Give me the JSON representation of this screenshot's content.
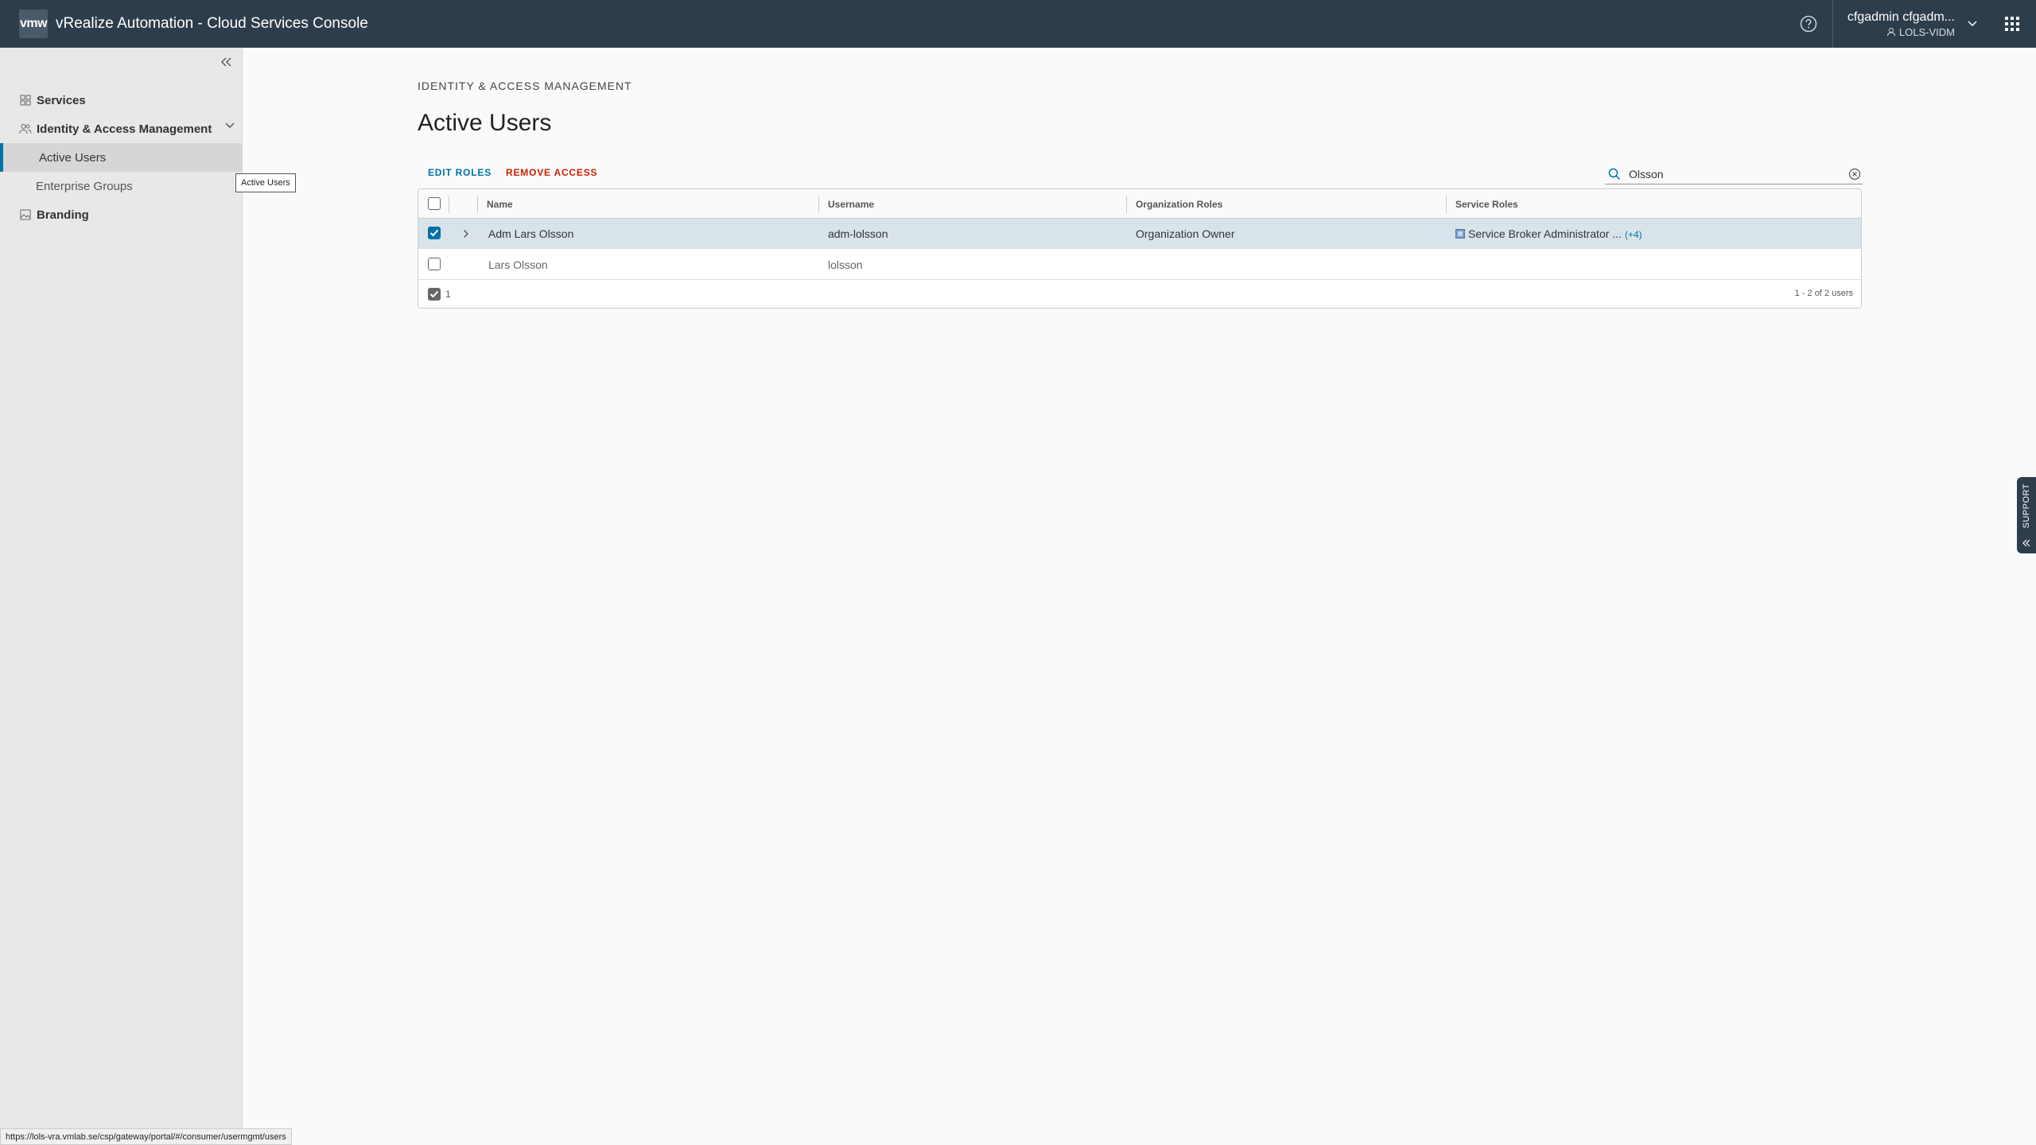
{
  "header": {
    "logo_text": "vmw",
    "app_title": "vRealize Automation - Cloud Services Console",
    "user_name": "cfgadmin cfgadm...",
    "user_org": "LOLS-VIDM"
  },
  "sidebar": {
    "items": [
      {
        "label": "Services",
        "icon": "grid-icon"
      },
      {
        "label": "Identity & Access Management",
        "icon": "users-icon"
      },
      {
        "label": "Active Users"
      },
      {
        "label": "Enterprise Groups"
      },
      {
        "label": "Branding",
        "icon": "image-icon"
      }
    ]
  },
  "tooltip": "Active Users",
  "main": {
    "breadcrumb": "IDENTITY & ACCESS MANAGEMENT",
    "title": "Active Users",
    "actions": {
      "edit_roles": "EDIT ROLES",
      "remove_access": "REMOVE ACCESS"
    },
    "search_value": "Olsson"
  },
  "table": {
    "columns": [
      "Name",
      "Username",
      "Organization Roles",
      "Service Roles"
    ],
    "rows": [
      {
        "name": "Adm Lars Olsson",
        "username": "adm-lolsson",
        "org_roles": "Organization Owner",
        "service_roles": "Service Broker Administrator ...",
        "more": "(+4)",
        "selected": true
      },
      {
        "name": "Lars Olsson",
        "username": "lolsson",
        "org_roles": "",
        "service_roles": "",
        "more": "",
        "selected": false
      }
    ],
    "selected_count": "1",
    "pagination": "1 - 2 of 2 users"
  },
  "support_label": "SUPPORT",
  "status_url": "https://lols-vra.vmlab.se/csp/gateway/portal/#/consumer/usermgmt/users",
  "colors": {
    "header_bg": "#2e3d4b",
    "accent": "#0072a3",
    "danger": "#c92100"
  }
}
